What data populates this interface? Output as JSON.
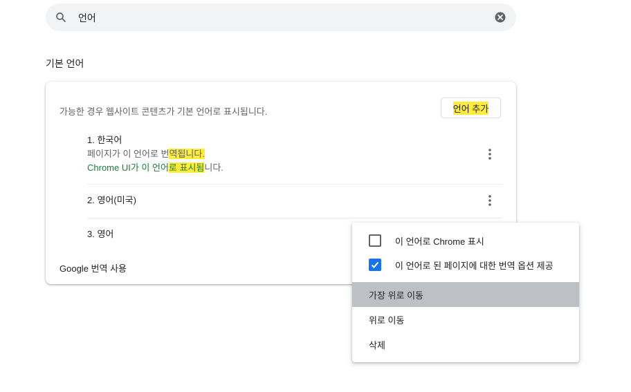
{
  "search": {
    "query": "언어"
  },
  "section_title": "기본 언어",
  "card": {
    "description": "가능한 경우 웹사이트 콘텐츠가 기본 언어로 표시됩니다.",
    "add_button": "언어 추가",
    "languages": [
      {
        "label": "1. 한국어",
        "line1_plain": "페이지가 이 언어로 번",
        "line1_hl": "역됩니다.",
        "line2_plain_a": "Chrome UI가 이 언어",
        "line2_hl": "로 표시됨",
        "line2_plain_b": "니다."
      },
      {
        "label": "2. 영어(미국)"
      },
      {
        "label": "3. 영어"
      }
    ],
    "google_translate_label": "Google 번역 사용"
  },
  "context_menu": {
    "display_chrome": {
      "label": "이 언어로 Chrome 표시",
      "checked": false
    },
    "offer_translate": {
      "label": "이 언어로 된 페이지에 대한 번역 옵션 제공",
      "checked": true
    },
    "move_top": "가장 위로 이동",
    "move_up": "위로 이동",
    "remove": "삭제"
  },
  "colors": {
    "highlight": "#ffeb3b",
    "accent": "#1a73e8",
    "green_text": "#188038",
    "menu_hover": "#bdc1c6"
  }
}
